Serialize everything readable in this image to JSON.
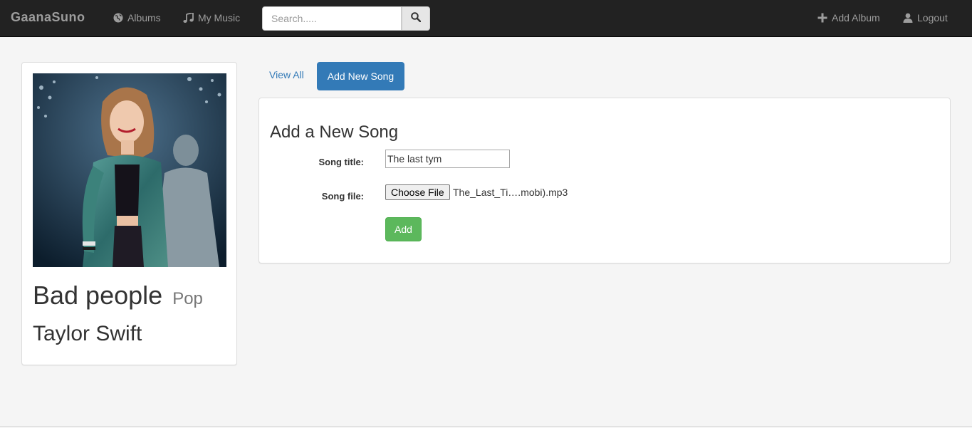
{
  "navbar": {
    "brand": "GaanaSuno",
    "albums_label": "Albums",
    "my_music_label": "My Music",
    "search_placeholder": "Search.....",
    "add_album_label": "Add Album",
    "logout_label": "Logout"
  },
  "album": {
    "title": "Bad people",
    "genre": "Pop",
    "artist": "Taylor Swift"
  },
  "tabs": {
    "view_all": "View All",
    "add_new_song": "Add New Song"
  },
  "form": {
    "heading": "Add a New Song",
    "song_title_label": "Song title:",
    "song_title_value": "The last tym",
    "song_file_label": "Song file:",
    "choose_file_label": "Choose File",
    "file_name": "The_Last_Ti….mobi).mp3",
    "submit_label": "Add"
  },
  "colors": {
    "navbar": "#222222",
    "primary": "#337ab7",
    "success": "#5cb85c",
    "background": "#f5f5f5"
  }
}
